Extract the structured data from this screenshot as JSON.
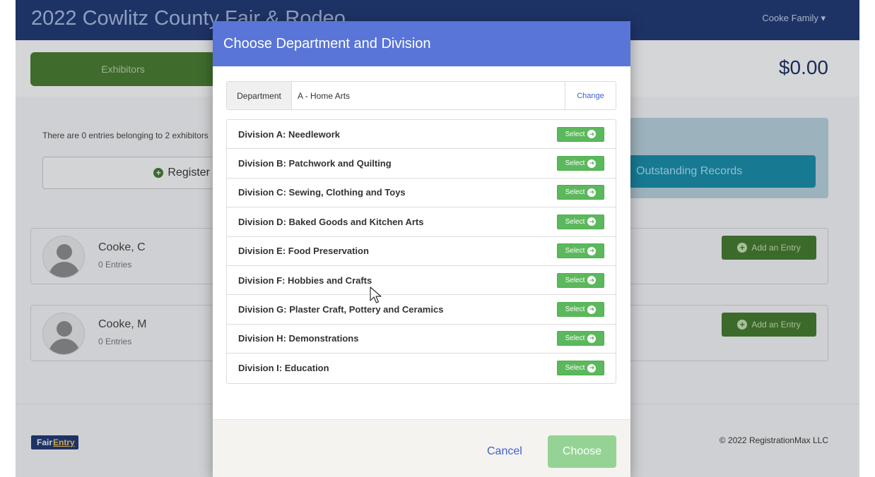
{
  "header": {
    "site_title": "2022 Cowlitz County Fair & Rodeo",
    "user_menu": "Cooke Family",
    "user_menu_icon": "caret-down-icon"
  },
  "topbar": {
    "tab_exhibitors": "Exhibitors",
    "total": "$0.00"
  },
  "content": {
    "info_text": "There are 0 entries belonging to 2 exhibitors",
    "register_label": "Register",
    "outstanding_label": "Outstanding Records"
  },
  "exhibitors": [
    {
      "name": "Cooke, C",
      "entries": "0 Entries",
      "add_label": "Add an Entry"
    },
    {
      "name": "Cooke, M",
      "entries": "0 Entries",
      "add_label": "Add an Entry"
    }
  ],
  "footer": {
    "logo_part1": "Fair",
    "logo_part2": "Entry",
    "copyright": "© 2022 RegistrationMax LLC"
  },
  "modal": {
    "title": "Choose Department and Division",
    "department_label": "Department",
    "department_value": "A - Home Arts",
    "change_label": "Change",
    "select_label": "Select",
    "divisions": [
      "Division A: Needlework",
      "Division B: Patchwork and Quilting",
      "Division C: Sewing, Clothing and Toys",
      "Division D: Baked Goods and Kitchen Arts",
      "Division E: Food Preservation",
      "Division F: Hobbies and Crafts",
      "Division G: Plaster Craft, Pottery and Ceramics",
      "Division H: Demonstrations",
      "Division I: Education"
    ],
    "cancel_label": "Cancel",
    "choose_label": "Choose"
  },
  "colors": {
    "header_bg": "#1e3365",
    "modal_header_bg": "#5975d7",
    "select_green": "#5cb85c",
    "choose_disabled": "#95d395",
    "link_blue": "#3f5fd0"
  }
}
